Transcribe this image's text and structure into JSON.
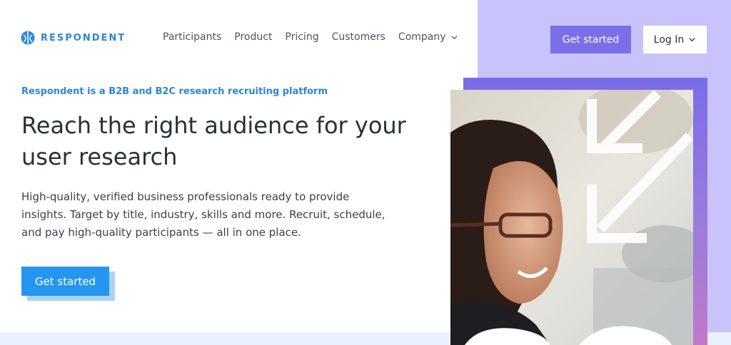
{
  "brand": {
    "name": "RESPONDENT"
  },
  "nav": {
    "items": [
      {
        "label": "Participants"
      },
      {
        "label": "Product"
      },
      {
        "label": "Pricing"
      },
      {
        "label": "Customers"
      },
      {
        "label": "Company"
      }
    ]
  },
  "header": {
    "get_started_label": "Get started",
    "login_label": "Log In"
  },
  "hero": {
    "eyebrow": "Respondent is a B2B and B2C research recruiting platform",
    "headline_before": "Reach the ",
    "headline_highlight": "right audience",
    "headline_after": " for your user research",
    "body": "High-quality, verified business professionals ready to provide insights. Target by title, industry, skills and more. Recruit, schedule, and pay high-quality participants — all in one place.",
    "cta_label": "Get started"
  },
  "colors": {
    "accent_blue": "#2496f0",
    "brand_blue": "#2e86d6",
    "accent_purple": "#7b6ee8",
    "panel_lavender": "#c9c3fb"
  },
  "icons": [
    "respondent-logo-icon",
    "chevron-down-icon",
    "arrows-icon"
  ]
}
